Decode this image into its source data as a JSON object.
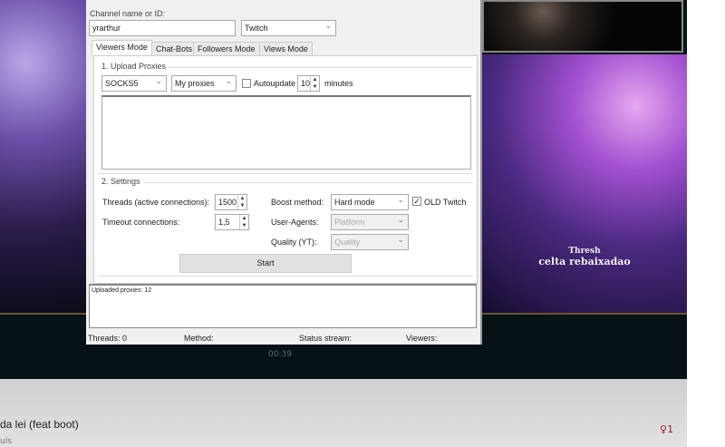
{
  "window": {
    "channel_label": "Channel name or ID:",
    "channel_value": "yrarthur",
    "platform": "Twitch",
    "tabs": [
      {
        "label": "Viewers Mode",
        "active": true
      },
      {
        "label": "Chat-Bots"
      },
      {
        "label": "Followers Mode"
      },
      {
        "label": "Views Mode"
      }
    ],
    "upload": {
      "title": "1. Upload Proxies",
      "proxy_type": "SOCKS5",
      "proxy_source": "My proxies",
      "autoupdate_label": "Autoupdate",
      "autoupdate_checked": false,
      "autoupdate_value": "10",
      "minutes_label": "minutes",
      "proxy_text": ""
    },
    "settings": {
      "title": "2. Settings",
      "threads_label": "Threads (active connections):",
      "threads_value": "1500",
      "timeout_label": "Timeout connections:",
      "timeout_value": "1,5",
      "boost_label": "Boost method:",
      "boost_value": "Hard mode",
      "old_twitch_label": "OLD Twitch",
      "old_twitch_checked": true,
      "ua_label": "User-Agents:",
      "ua_value": "Platform",
      "quality_label": "Quality (YT):",
      "quality_value": "Quality"
    },
    "start_label": "Start",
    "log": "Uploaded proxies: 12",
    "status": {
      "threads": "Threads: 0",
      "method": "Method:",
      "stream": "Status stream:",
      "viewers": "Viewers:"
    }
  },
  "stream": {
    "champion": "Thresh",
    "player": "celta rebaixadao",
    "timer": "00:39",
    "title": "da lei (feat boot)",
    "subtitle": "uís",
    "viewer_count": "1",
    "accent": "#a01830"
  }
}
